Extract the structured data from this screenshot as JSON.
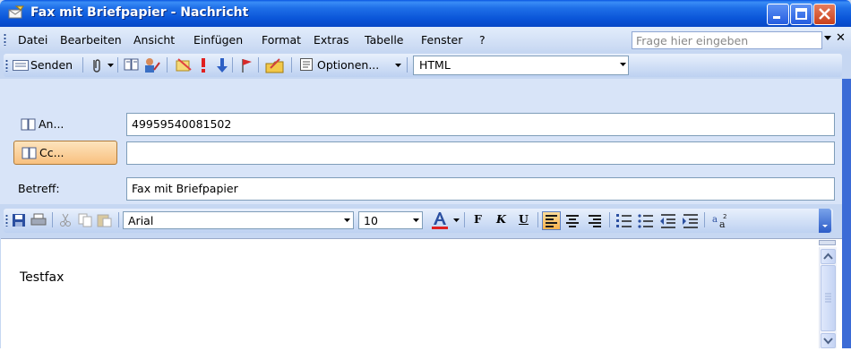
{
  "window": {
    "title": "Fax mit Briefpapier - Nachricht",
    "icon": "envelope-icon"
  },
  "menubar": {
    "items": [
      {
        "label": "Datei"
      },
      {
        "label": "Bearbeiten"
      },
      {
        "label": "Ansicht"
      },
      {
        "label": "Einfügen"
      },
      {
        "label": "Format"
      },
      {
        "label": "Extras"
      },
      {
        "label": "Tabelle"
      },
      {
        "label": "Fenster"
      },
      {
        "label": "?"
      }
    ],
    "help_placeholder": "Frage hier eingeben"
  },
  "toolbar": {
    "send_label": "Senden",
    "options_label": "Optionen...",
    "format_value": "HTML"
  },
  "header": {
    "to_label": "An...",
    "to_value": "49959540081502",
    "cc_label": "Cc...",
    "cc_value": "",
    "subject_label": "Betreff:",
    "subject_value": "Fax mit Briefpapier"
  },
  "formatting": {
    "font": "Arial",
    "size": "10",
    "bold_label": "F",
    "italic_label": "K",
    "underline_label": "U",
    "font_color": "#e02020",
    "active_alignment": "left"
  },
  "body": {
    "text": "Testfax"
  },
  "colors": {
    "titlebar": "#0a55e0",
    "toolbar": "#c6d7f2",
    "highlight": "#f8c07f"
  }
}
